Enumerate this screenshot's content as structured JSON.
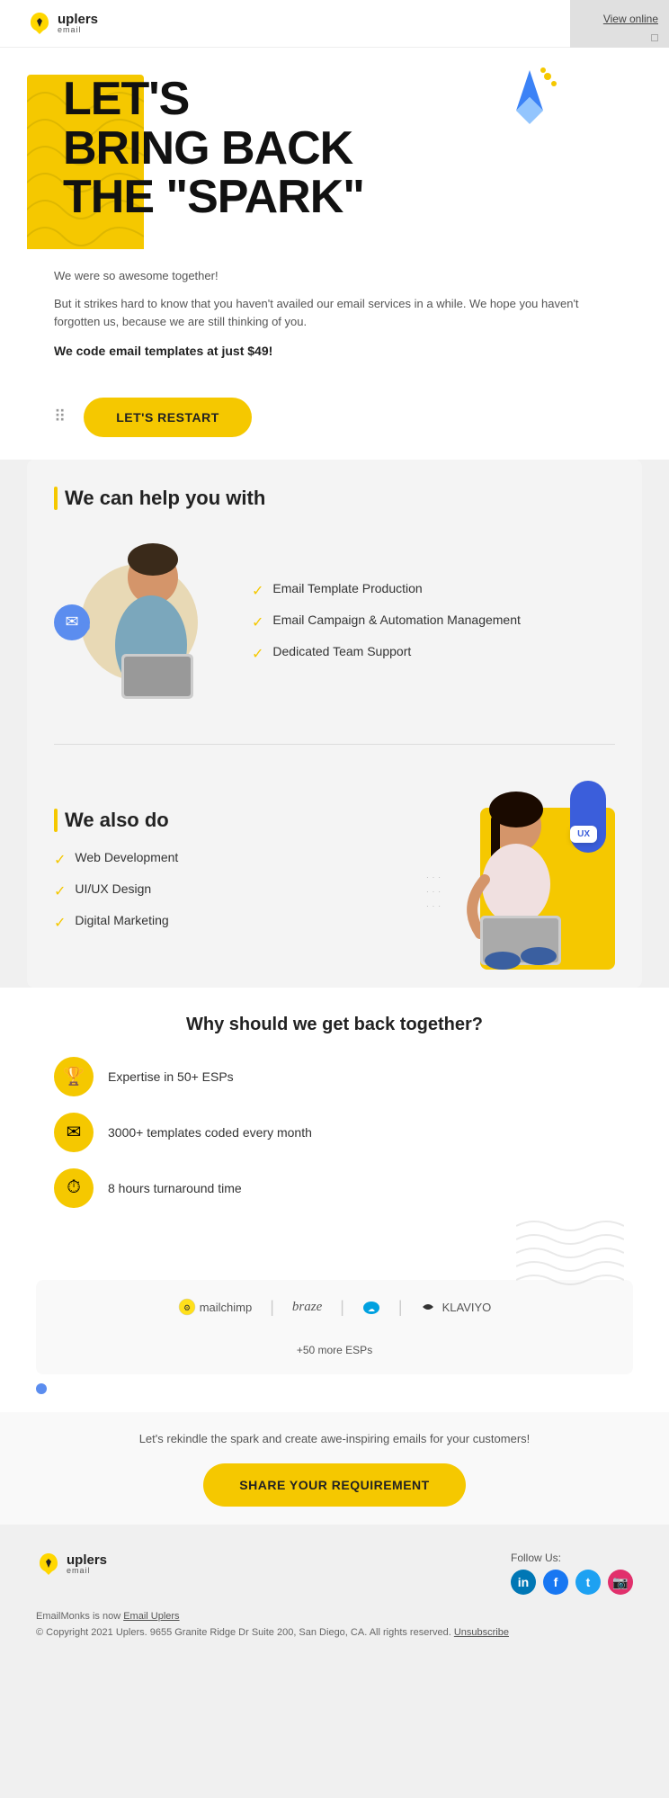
{
  "header": {
    "logo_main": "uplers",
    "logo_sub": "email",
    "view_online": "View online"
  },
  "hero": {
    "title_line1": "LET'S",
    "title_line2": "BRING BACK",
    "title_line3": "THE \"SPARK\""
  },
  "subtext": {
    "line1": "We were so awesome together!",
    "line2": "But it strikes hard to know that you haven't availed our email services in a while. We hope you haven't forgotten us, because we are still thinking of you.",
    "line3": "We code email templates at just $49!"
  },
  "cta": {
    "label": "LET'S RESTART"
  },
  "help_section": {
    "title": "We can help you with",
    "items": [
      "Email Template Production",
      "Email Campaign & Automation Management",
      "Dedicated Team Support"
    ]
  },
  "also_section": {
    "title": "We also do",
    "items": [
      "Web Development",
      "UI/UX Design",
      "Digital Marketing"
    ]
  },
  "why_section": {
    "title": "Why should we get back together?",
    "items": [
      {
        "icon": "🏆",
        "text": "Expertise in 50+ ESPs"
      },
      {
        "icon": "✉",
        "text": "3000+ templates coded every month"
      },
      {
        "icon": "⏱",
        "text": "8 hours turnaround time"
      }
    ]
  },
  "esp_section": {
    "logos": [
      {
        "name": "mailchimp",
        "symbol": "⚙"
      },
      {
        "name": "braze",
        "symbol": "𝒃"
      },
      {
        "name": "salesforce",
        "symbol": "☁"
      },
      {
        "name": "KLAVIYO",
        "symbol": "〜"
      }
    ],
    "more": "+50 more ESPs"
  },
  "rekindle": {
    "text": "Let's rekindle the spark and create awe-inspiring emails for your customers!",
    "cta": "SHARE YOUR REQUIREMENT"
  },
  "footer": {
    "logo_main": "uplers",
    "logo_sub": "email",
    "follow_label": "Follow Us:",
    "emailmonks_text": "EmailMonks is now ",
    "emailmonks_link": "Email Uplers",
    "copyright": "© Copyright 2021 Uplers. 9655 Granite Ridge Dr Suite 200, San Diego, CA. All rights reserved. ",
    "unsubscribe": "Unsubscribe",
    "social": [
      {
        "name": "linkedin",
        "class": "social-linkedin",
        "label": "in"
      },
      {
        "name": "facebook",
        "class": "social-facebook",
        "label": "f"
      },
      {
        "name": "twitter",
        "class": "social-twitter",
        "label": "t"
      },
      {
        "name": "instagram",
        "class": "social-instagram",
        "label": "📷"
      }
    ]
  }
}
